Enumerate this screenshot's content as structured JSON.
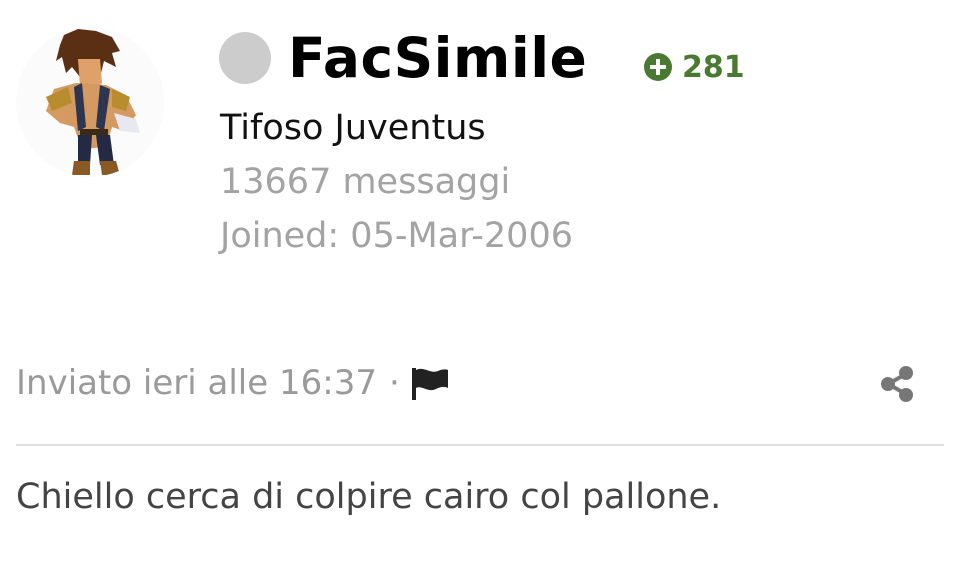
{
  "user": {
    "username": "FacSimile",
    "reputation": "281",
    "title": "Tifoso Juventus",
    "posts": "13667 messaggi",
    "joined": "Joined: 05-Mar-2006"
  },
  "post": {
    "posted_at": "Inviato ieri alle 16:37",
    "separator": "·",
    "body": "Chiello cerca di colpire cairo col pallone."
  },
  "colors": {
    "reputation": "#4a7a32",
    "muted": "#9a9a9a",
    "status_offline": "#cccccc"
  },
  "icons": [
    "avatar",
    "status-dot",
    "plus-circle-icon",
    "flag-icon",
    "share-icon"
  ]
}
